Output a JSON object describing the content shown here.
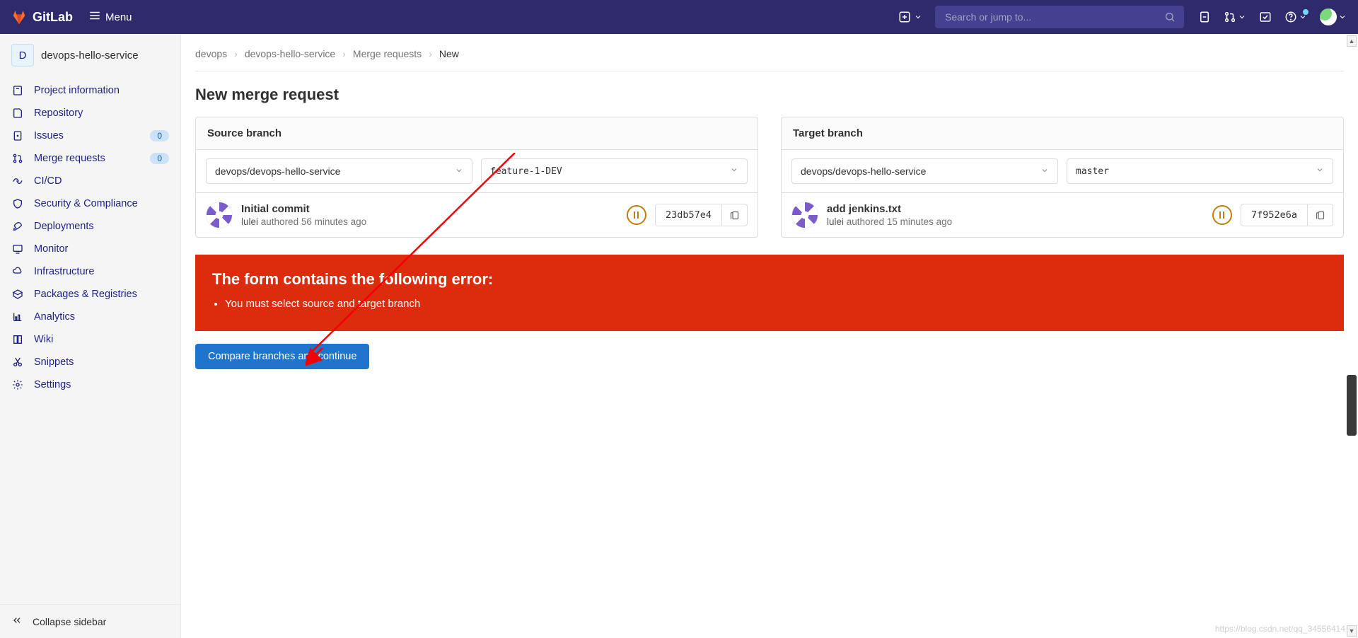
{
  "topbar": {
    "brand": "GitLab",
    "menu_label": "Menu",
    "search_placeholder": "Search or jump to..."
  },
  "sidebar": {
    "context": {
      "letter": "D",
      "name": "devops-hello-service"
    },
    "items": [
      {
        "icon": "info",
        "label": "Project information"
      },
      {
        "icon": "repo",
        "label": "Repository"
      },
      {
        "icon": "issues",
        "label": "Issues",
        "badge": "0"
      },
      {
        "icon": "merge",
        "label": "Merge requests",
        "badge": "0"
      },
      {
        "icon": "cicd",
        "label": "CI/CD"
      },
      {
        "icon": "shield",
        "label": "Security & Compliance"
      },
      {
        "icon": "rocket",
        "label": "Deployments"
      },
      {
        "icon": "monitor",
        "label": "Monitor"
      },
      {
        "icon": "infra",
        "label": "Infrastructure"
      },
      {
        "icon": "package",
        "label": "Packages & Registries"
      },
      {
        "icon": "chart",
        "label": "Analytics"
      },
      {
        "icon": "wiki",
        "label": "Wiki"
      },
      {
        "icon": "snippet",
        "label": "Snippets"
      },
      {
        "icon": "settings",
        "label": "Settings"
      }
    ],
    "collapse_label": "Collapse sidebar"
  },
  "breadcrumbs": [
    "devops",
    "devops-hello-service",
    "Merge requests",
    "New"
  ],
  "page_title": "New merge request",
  "source": {
    "panel_title": "Source branch",
    "project": "devops/devops-hello-service",
    "branch": "feature-1-DEV",
    "commit": {
      "title": "Initial commit",
      "author": "lulei",
      "authored_word": "authored",
      "when": "56 minutes ago",
      "sha": "23db57e4"
    }
  },
  "target": {
    "panel_title": "Target branch",
    "project": "devops/devops-hello-service",
    "branch": "master",
    "commit": {
      "title": "add jenkins.txt",
      "author": "lulei",
      "authored_word": "authored",
      "when": "15 minutes ago",
      "sha": "7f952e6a"
    }
  },
  "error": {
    "heading": "The form contains the following error:",
    "items": [
      "You must select source and target branch"
    ]
  },
  "submit_label": "Compare branches and continue",
  "watermark": "https://blog.csdn.net/qq_34556414"
}
